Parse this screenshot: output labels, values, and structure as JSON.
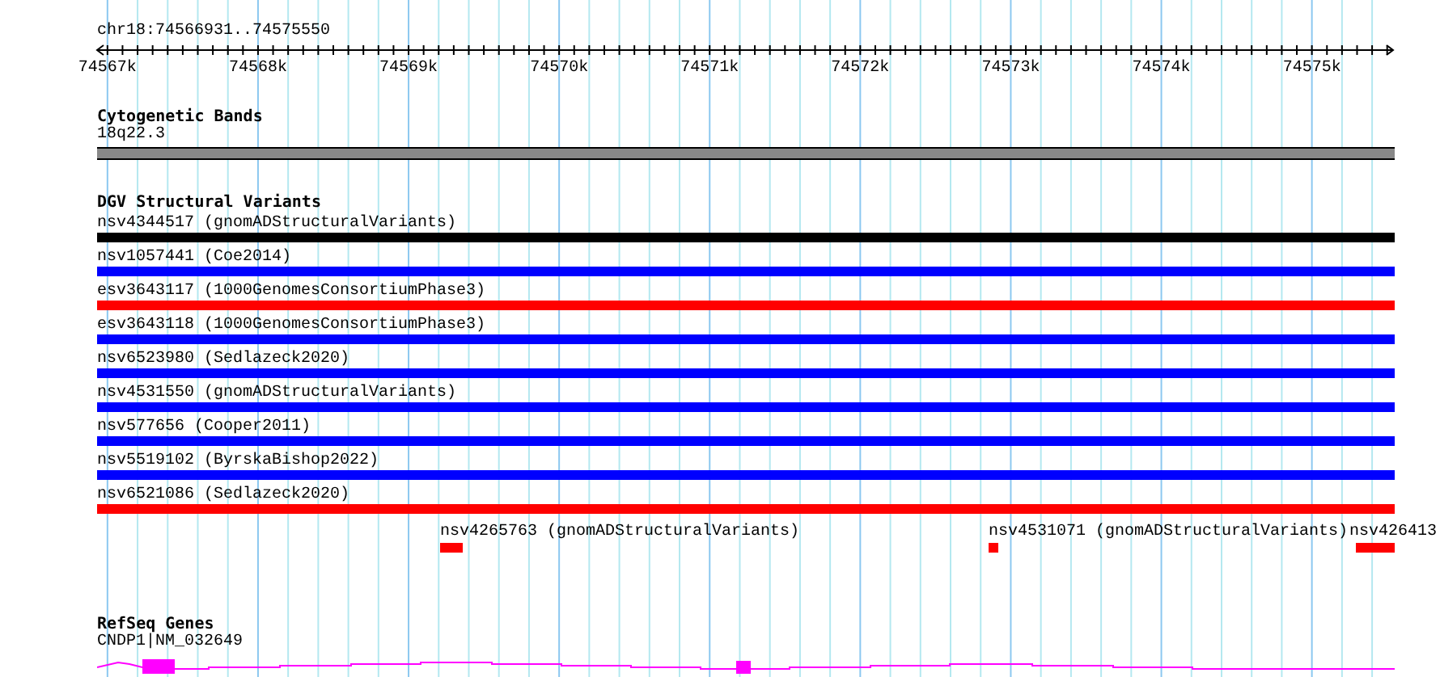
{
  "region": "chr18:74566931..74575550",
  "ruler": {
    "labels": [
      "74567k",
      "74568k",
      "74569k",
      "74570k",
      "74571k",
      "74572k",
      "74573k",
      "74574k",
      "74575k"
    ]
  },
  "tracks": [
    {
      "kind": "bands",
      "title": "Cytogenetic Bands",
      "features": [
        {
          "label": "18q22.3",
          "color": "#888888"
        }
      ]
    },
    {
      "kind": "variants",
      "title": "DGV Structural Variants",
      "features": [
        {
          "label": "nsv4344517 (gnomADStructuralVariants)",
          "color": "#000000"
        },
        {
          "label": "nsv1057441 (Coe2014)",
          "color": "#0000ff"
        },
        {
          "label": "esv3643117 (1000GenomesConsortiumPhase3)",
          "color": "#ff0000"
        },
        {
          "label": "esv3643118 (1000GenomesConsortiumPhase3)",
          "color": "#0000ff"
        },
        {
          "label": "nsv6523980 (Sedlazeck2020)",
          "color": "#0000ff"
        },
        {
          "label": "nsv4531550 (gnomADStructuralVariants)",
          "color": "#0000ff"
        },
        {
          "label": "nsv577656 (Cooper2011)",
          "color": "#0000ff"
        },
        {
          "label": "nsv5519102 (ByrskaBishop2022)",
          "color": "#0000ff"
        },
        {
          "label": "nsv6521086 (Sedlazeck2020)",
          "color": "#ff0000"
        }
      ],
      "small": [
        {
          "label": "nsv4265763 (gnomADStructuralVariants)",
          "color": "#ff0000"
        },
        {
          "label": "nsv4531071 (gnomADStructuralVariants)",
          "color": "#ff0000"
        },
        {
          "label": "nsv426413",
          "color": "#ff0000"
        }
      ]
    },
    {
      "kind": "genes",
      "title": "RefSeq Genes",
      "features": [
        {
          "label": "CNDP1|NM_032649",
          "color": "#ff00ff"
        }
      ]
    }
  ]
}
